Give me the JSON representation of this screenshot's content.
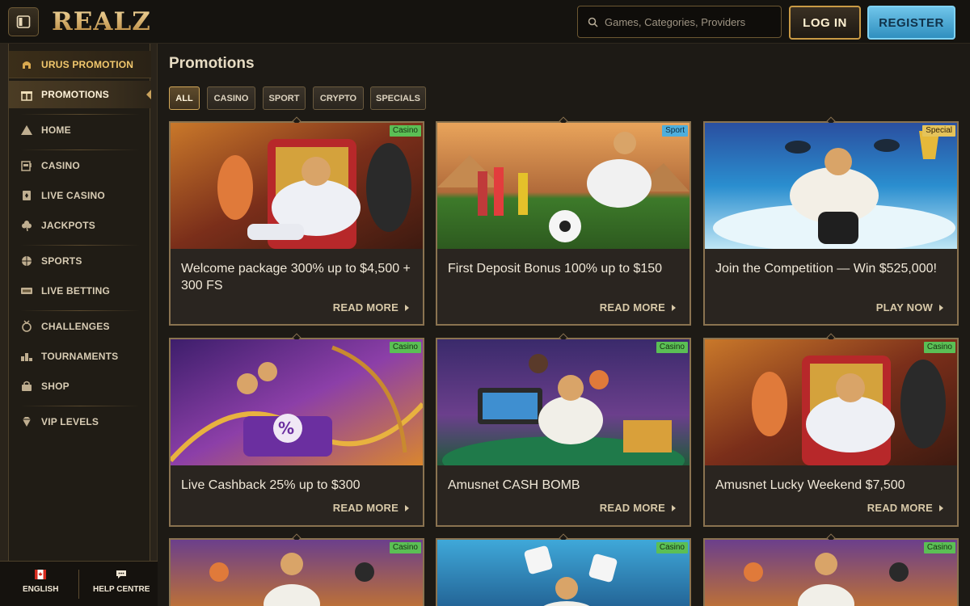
{
  "header": {
    "logo_text": "REALZ",
    "search_placeholder": "Games, Categories, Providers",
    "login_label": "LOG IN",
    "register_label": "REGISTER"
  },
  "sidebar": {
    "items": [
      {
        "label": "URUS PROMOTION",
        "icon": "helmet-icon"
      },
      {
        "label": "PROMOTIONS",
        "icon": "gift-icon"
      },
      {
        "label": "HOME",
        "icon": "pyramid-icon"
      },
      {
        "label": "CASINO",
        "icon": "slot-machine-icon"
      },
      {
        "label": "LIVE CASINO",
        "icon": "playing-card-icon"
      },
      {
        "label": "JACKPOTS",
        "icon": "clover-icon"
      },
      {
        "label": "SPORTS",
        "icon": "basketball-icon"
      },
      {
        "label": "LIVE BETTING",
        "icon": "live-badge-icon"
      },
      {
        "label": "CHALLENGES",
        "icon": "medal-icon"
      },
      {
        "label": "TOURNAMENTS",
        "icon": "podium-icon"
      },
      {
        "label": "SHOP",
        "icon": "shopping-bag-icon"
      },
      {
        "label": "VIP LEVELS",
        "icon": "diamond-icon"
      }
    ],
    "footer": {
      "language_label": "ENGLISH",
      "help_label": "HELP CENTRE"
    }
  },
  "main": {
    "title": "Promotions",
    "filters": [
      "ALL",
      "CASINO",
      "SPORT",
      "CRYPTO",
      "SPECIALS"
    ],
    "active_filter": "ALL",
    "cards": [
      {
        "title": "Welcome package 300% up to $4,500 + 300 FS",
        "cta": "READ MORE",
        "tag": "Casino"
      },
      {
        "title": "First Deposit Bonus 100% up to $150",
        "cta": "READ MORE",
        "tag": "Sport"
      },
      {
        "title": "Join the Competition — Win $525,000!",
        "cta": "PLAY NOW",
        "tag": "Special"
      },
      {
        "title": "Live Cashback 25% up to $300",
        "cta": "READ MORE",
        "tag": "Casino"
      },
      {
        "title": "Amusnet CASH BOMB",
        "cta": "READ MORE",
        "tag": "Casino"
      },
      {
        "title": "Amusnet Lucky Weekend $7,500",
        "cta": "READ MORE",
        "tag": "Casino"
      },
      {
        "title": "",
        "cta": "",
        "tag": "Casino"
      },
      {
        "title": "",
        "cta": "",
        "tag": "Casino"
      },
      {
        "title": "",
        "cta": "",
        "tag": "Casino"
      }
    ]
  },
  "colors": {
    "accent_gold": "#d0a658",
    "register_blue": "#4eaedc",
    "tag_casino": "#5bbf55",
    "tag_sport": "#4eaedc",
    "tag_special": "#e5c35a"
  }
}
